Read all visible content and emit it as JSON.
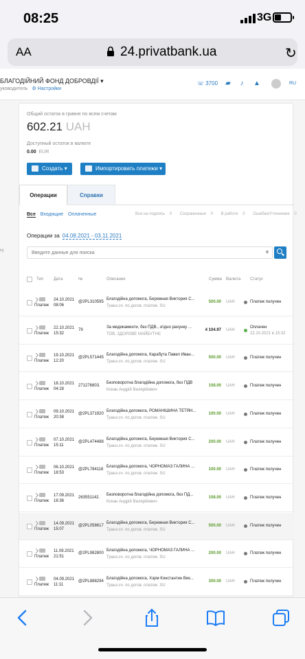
{
  "status_bar": {
    "time": "08:25",
    "network": "3G"
  },
  "url_bar": {
    "text_size": "AA",
    "url": "24.privatbank.ua"
  },
  "header": {
    "org_name": "БЛАГОДІЙНИЙ ФОНД ДОБРОВДІЇ",
    "role": "уководитель",
    "settings": "Настройки",
    "phone": "3700",
    "lang": "RU"
  },
  "balance": {
    "total_label": "Общий остаток в гривне по всем счетам",
    "amount": "602.21",
    "currency": "UAH",
    "fx_label": "Доступный остаток в валюте",
    "fx_amount": "0.00",
    "fx_currency": "EUR"
  },
  "actions": {
    "create": "Создать",
    "import": "Импортировать платежи"
  },
  "tabs": [
    "Операции",
    "Справки"
  ],
  "filters": {
    "all": "Все",
    "incoming": "Входящие",
    "paid": "Оплаченные",
    "on_sign": "Все на подпись",
    "on_sign_count": "0",
    "saved": "Сохраненные",
    "saved_count": "0",
    "in_work": "В работе",
    "in_work_count": "0",
    "errors": "Ошибки/Уточнение",
    "errors_count": "0"
  },
  "period": {
    "label": "Операции за",
    "range": "04.08.2021 - 03.11.2021"
  },
  "search": {
    "placeholder": "Введите данные для поиска"
  },
  "table": {
    "headers": {
      "type": "Тип",
      "date": "Дата",
      "num": "№",
      "desc": "Описание",
      "sum": "Сумма",
      "cur": "Валюта",
      "status": "Статус"
    },
    "rows": [
      {
        "type": "Платеж",
        "date": "24.10.2021",
        "time": "08:06",
        "num": "@2PL310595",
        "desc1": "Благодійна допомога, Бережная Виктория С...",
        "desc2": "Транз.сч. по догов. платеж. SU",
        "sum": "500.00",
        "cur": "UAH",
        "status": "Платеж получен",
        "status2": ""
      },
      {
        "type": "Платеж",
        "date": "22.10.2021",
        "time": "15:32",
        "num": "79",
        "desc1": "За медикаменти, без ПДВ., згідно рахунку ...",
        "desc2": "ТОВ, ЗДОРОВЕ МАЙБУТНЄ",
        "sum": "4 104.97",
        "cur": "UAH",
        "status": "Оплачен",
        "status2": "22.10.2021 в 15:32"
      },
      {
        "type": "Платеж",
        "date": "19.10.2021",
        "time": "12:20",
        "num": "@2PL571445",
        "desc1": "Благодійна допомога, Карабута Павел Иван...",
        "desc2": "Транз.сч. по догов. платеж. SU",
        "sum": "500.00",
        "cur": "UAH",
        "status": "Платеж получен",
        "status2": ""
      },
      {
        "type": "Платеж",
        "date": "18.10.2021",
        "time": "04:28",
        "num": "271276803.",
        "desc1": "Безповоротна благодійна допомога, без ПДВ",
        "desc2": "Кохан Андрій Валерійович",
        "sum": "108.00",
        "cur": "UAH",
        "status": "Платеж получен",
        "status2": ""
      },
      {
        "type": "Платеж",
        "date": "09.10.2021",
        "time": "20:38",
        "num": "@2PL371920",
        "desc1": "Благодійна допомога, РОМАНІШИНА ТЕТЯН...",
        "desc2": "Транз.сч. по догов. платеж. SU",
        "sum": "100.00",
        "cur": "UAH",
        "status": "Платеж получен",
        "status2": ""
      },
      {
        "type": "Платеж",
        "date": "07.10.2021",
        "time": "15:11",
        "num": "@2PL474488",
        "desc1": "Благодійна допомога, Бережная Виктория С...",
        "desc2": "Транз.сч. по догов. платеж. SU",
        "sum": "200.00",
        "cur": "UAH",
        "status": "Платеж получен",
        "status2": ""
      },
      {
        "type": "Платеж",
        "date": "06.10.2021",
        "time": "18:53",
        "num": "@2PL784118",
        "desc1": "Благодійна допомога, ЧОРНОМАЗ ГАЛИНА ...",
        "desc2": "Транз.сч. по догов. платеж. SU",
        "sum": "100.00",
        "cur": "UAH",
        "status": "Платеж получен",
        "status2": ""
      },
      {
        "type": "Платеж",
        "date": "17.09.2021",
        "time": "16:36",
        "num": "263551142.",
        "desc1": "Безповоротна благодійна допомога, без ПД...",
        "desc2": "Кохан Андрій Валерійович",
        "sum": "108.00",
        "cur": "UAH",
        "status": "Платеж получен",
        "status2": ""
      },
      {
        "type": "Платеж",
        "date": "14.09.2021",
        "time": "15:07",
        "num": "@2PL058617",
        "desc1": "Благодійна допомога, Бережная Виктория С...",
        "desc2": "Транз.сч. по догов. платеж. SU",
        "sum": "500.00",
        "cur": "UAH",
        "status": "Платеж получен",
        "status2": ""
      },
      {
        "type": "Платеж",
        "date": "11.09.2021",
        "time": "21:51",
        "num": "@2PL982800",
        "desc1": "Благодійна допомога, ЧОРНОМАЗ ГАЛИНА ...",
        "desc2": "Транз.сч. по догов. платеж. SU",
        "sum": "200.00",
        "cur": "UAH",
        "status": "Платеж получен",
        "status2": ""
      },
      {
        "type": "Платеж",
        "date": "04.09.2021",
        "time": "11:11",
        "num": "@2PL888294",
        "desc1": "Благодійна допомога, Хэрм Константин Вик...",
        "desc2": "Транз.сч. по догов. платеж. SU",
        "sum": "300.00",
        "cur": "UAH",
        "status": "Платеж получен",
        "status2": ""
      }
    ]
  },
  "left_edge": [
    "ку"
  ]
}
